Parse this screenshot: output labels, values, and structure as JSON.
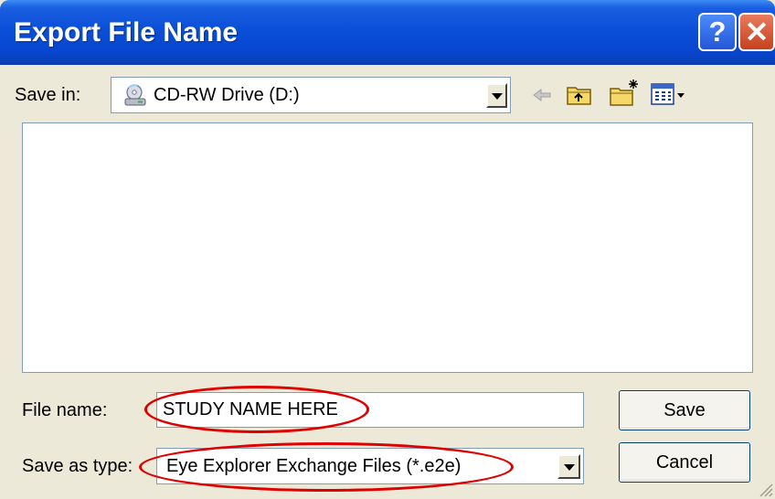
{
  "dialog": {
    "title": "Export File Name",
    "help_glyph": "?",
    "close_glyph": "✕"
  },
  "save_in": {
    "label": "Save in:",
    "value": "CD-RW Drive (D:)",
    "icon": "cd-drive-icon"
  },
  "toolbar": {
    "icons": [
      "back-arrow-icon",
      "up-one-level-icon",
      "new-folder-icon",
      "view-menu-icon"
    ]
  },
  "file_list": {
    "items": []
  },
  "file_name": {
    "label": "File name:",
    "value": "STUDY NAME HERE"
  },
  "save_as_type": {
    "label": "Save as type:",
    "value": "Eye Explorer Exchange Files (*.e2e)"
  },
  "buttons": {
    "save": "Save",
    "cancel": "Cancel"
  },
  "colors": {
    "titlebar": "#0A4FD8",
    "dialog_bg": "#ECE9D8",
    "annotation": "#E00000"
  }
}
